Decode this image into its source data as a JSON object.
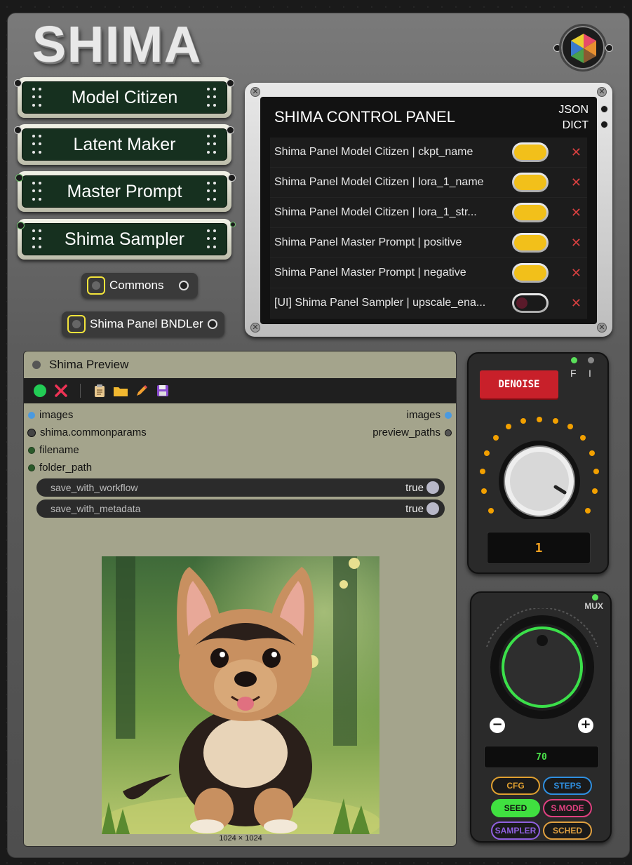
{
  "logo": {
    "text": "SHIMA"
  },
  "nodes": [
    {
      "label": "Model Citizen"
    },
    {
      "label": "Latent Maker"
    },
    {
      "label": "Master Prompt"
    },
    {
      "label": "Shima Sampler"
    }
  ],
  "mini_nodes": [
    {
      "label": "Commons"
    },
    {
      "label": "Shima Panel BNDLer"
    }
  ],
  "control_panel": {
    "title": "SHIMA CONTROL PANEL",
    "json_label": "JSON",
    "dict_label": "DICT",
    "rows": [
      {
        "label": "Shima Panel Model Citizen | ckpt_name",
        "on": true
      },
      {
        "label": "Shima Panel Model Citizen | lora_1_name",
        "on": true
      },
      {
        "label": "Shima Panel Model Citizen | lora_1_str...",
        "on": true
      },
      {
        "label": "Shima Panel Master Prompt | positive",
        "on": true
      },
      {
        "label": "Shima Panel Master Prompt | negative",
        "on": true
      },
      {
        "label": "[UI] Shima Panel Sampler | upscale_ena...",
        "on": false
      }
    ],
    "remove_glyph": "✕"
  },
  "preview": {
    "title": "Shima Preview",
    "inputs": [
      "images",
      "shima.commonparams",
      "filename",
      "folder_path"
    ],
    "outputs": [
      "images",
      "preview_paths"
    ],
    "widgets": [
      {
        "name": "save_with_workflow",
        "value": "true"
      },
      {
        "name": "save_with_metadata",
        "value": "true"
      }
    ],
    "image_size": "1024 × 1024"
  },
  "denoise_panel": {
    "button_label": "DENOISE",
    "f_label": "F",
    "i_label": "I",
    "value": "1"
  },
  "mux_panel": {
    "label": "MUX",
    "value": "70",
    "minus": "−",
    "plus": "+",
    "chips": [
      {
        "label": "CFG",
        "color": "#e0a030"
      },
      {
        "label": "STEPS",
        "color": "#2f8fe0"
      },
      {
        "label": "SEED",
        "color": "#40e040"
      },
      {
        "label": "S.MODE",
        "color": "#e04080"
      },
      {
        "label": "SAMPLER",
        "color": "#9060e0"
      },
      {
        "label": "SCHED",
        "color": "#e0a040"
      }
    ]
  },
  "colors": {
    "node_green": "#16301f",
    "toggle_on": "#f2c01a",
    "denoise_red": "#c8202a",
    "knob_ring": "#3be04a",
    "led_orange": "#f2a000"
  }
}
